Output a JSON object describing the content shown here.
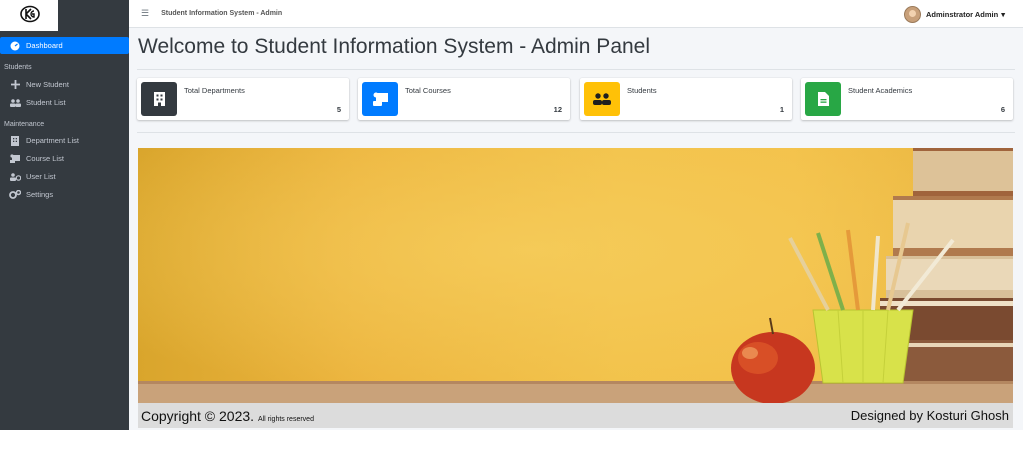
{
  "navbar": {
    "menu_icon": "bars-icon",
    "title": "Student Information System - Admin",
    "user_name": "Adminstrator Admin",
    "user_caret": "▾"
  },
  "sidebar": {
    "dashboard": "Dashboard",
    "header_students": "Students",
    "new_student": "New Student",
    "student_list": "Student List",
    "header_maintenance": "Maintenance",
    "department_list": "Department List",
    "course_list": "Course List",
    "user_list": "User List",
    "settings": "Settings"
  },
  "main": {
    "title": "Welcome to Student Information System - Admin Panel",
    "cards": [
      {
        "label": "Total Departments",
        "value": "5",
        "color": "#343a40",
        "icon": "building-icon"
      },
      {
        "label": "Total Courses",
        "value": "12",
        "color": "#007bff",
        "icon": "scroll-icon"
      },
      {
        "label": "Students",
        "value": "1",
        "color": "#ffc107",
        "icon": "users-icon"
      },
      {
        "label": "Student Academics",
        "value": "6",
        "color": "#28a745",
        "icon": "file-icon"
      }
    ]
  },
  "footer": {
    "copyright": "Copyright © 2023.",
    "rights": "All rights reserved",
    "designed_by": "Designed by Kosturi Ghosh"
  },
  "colors": {
    "sidebar_bg": "#343a40",
    "active": "#007bff",
    "banner": "#f2c24a"
  }
}
